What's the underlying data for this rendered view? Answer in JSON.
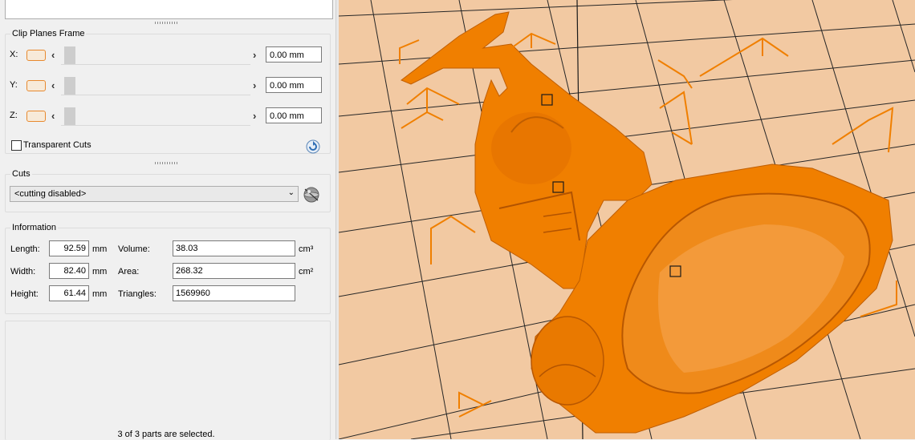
{
  "clip_planes": {
    "title": "Clip Planes Frame",
    "axes": [
      {
        "label": "X:",
        "value": "0.00 mm"
      },
      {
        "label": "Y:",
        "value": "0.00 mm"
      },
      {
        "label": "Z:",
        "value": "0.00 mm"
      }
    ],
    "transparent_cuts_label": "Transparent Cuts",
    "transparent_cuts_checked": false
  },
  "cuts": {
    "title": "Cuts",
    "selected": "<cutting disabled>"
  },
  "information": {
    "title": "Information",
    "length_label": "Length:",
    "length_value": "92.59",
    "width_label": "Width:",
    "width_value": "82.40",
    "height_label": "Height:",
    "height_value": "61.44",
    "unit_mm": "mm",
    "volume_label": "Volume:",
    "volume_value": "38.03",
    "volume_unit": "cm³",
    "area_label": "Area:",
    "area_value": "268.32",
    "area_unit": "cm²",
    "triangles_label": "Triangles:",
    "triangles_value": "1569960"
  },
  "status": {
    "selection_text": "3 of 3 parts are selected."
  },
  "colors": {
    "model_orange": "#f07f00",
    "bed_peach": "#f2c9a2",
    "grid_line": "#262626"
  }
}
